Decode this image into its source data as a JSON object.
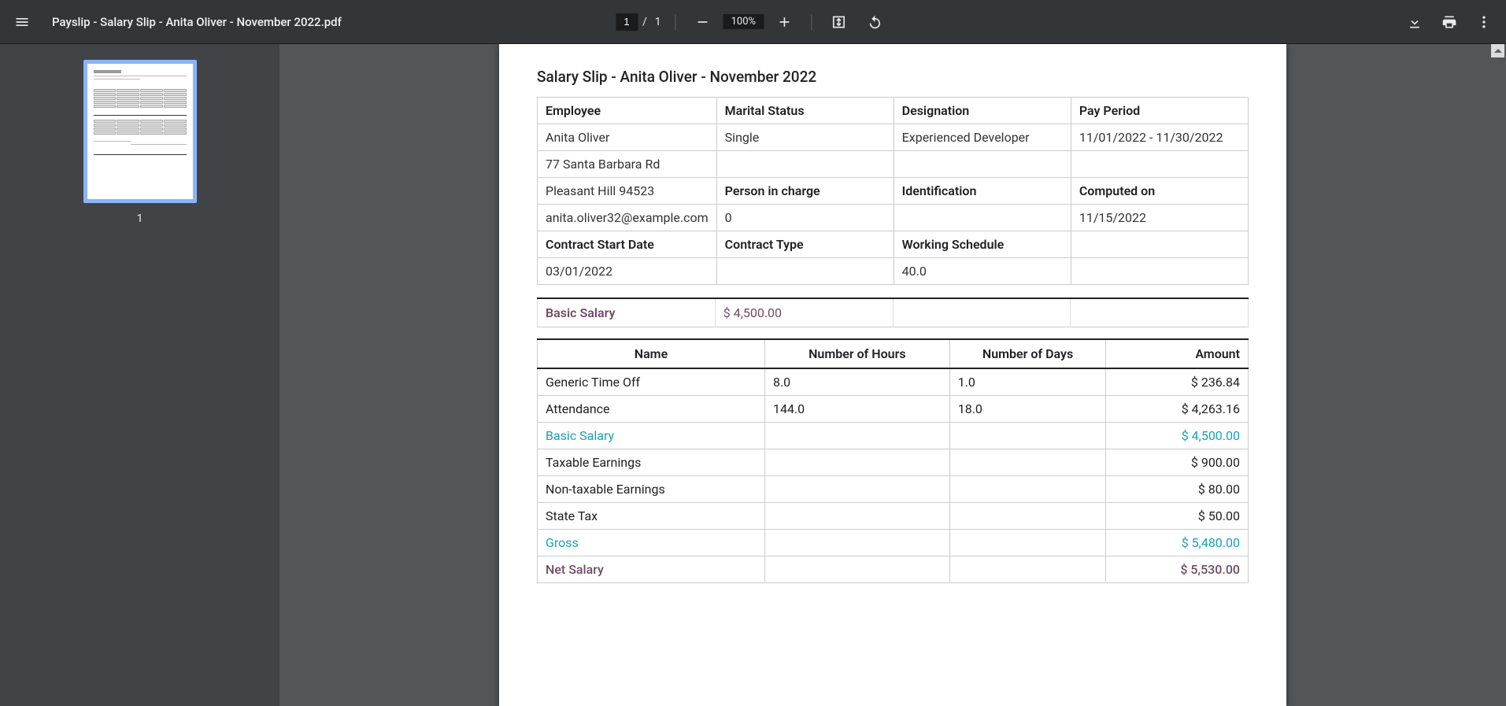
{
  "toolbar": {
    "title": "Payslip - Salary Slip - Anita Oliver - November 2022.pdf",
    "current_page": "1",
    "page_sep": "/",
    "total_pages": "1",
    "zoom": "100%"
  },
  "thumb": {
    "page_num": "1"
  },
  "doc": {
    "title": "Salary Slip - Anita Oliver - November 2022",
    "labels": {
      "employee": "Employee",
      "marital": "Marital Status",
      "designation": "Designation",
      "payperiod": "Pay Period",
      "person_in_charge": "Person in charge",
      "identification": "Identification",
      "computed_on": "Computed on",
      "contract_start": "Contract Start Date",
      "contract_type": "Contract Type",
      "working_schedule": "Working Schedule",
      "basic_salary": "Basic Salary"
    },
    "employee": {
      "name": "Anita Oliver",
      "marital": "Single",
      "designation": "Experienced Developer",
      "payperiod": "11/01/2022 - 11/30/2022",
      "addr1": "77 Santa Barbara Rd",
      "addr2": "Pleasant Hill 94523",
      "email": "anita.oliver32@example.com",
      "person_in_charge": "0",
      "identification": "",
      "computed_on": "11/15/2022",
      "contract_start": "03/01/2022",
      "contract_type": "",
      "working_schedule": "40.0"
    },
    "basic_salary_amount": "$ 4,500.00",
    "columns": {
      "name": "Name",
      "hours": "Number of Hours",
      "days": "Number of Days",
      "amount": "Amount"
    },
    "lines": [
      {
        "name": "Generic Time Off",
        "hours": "8.0",
        "days": "1.0",
        "amount": "$ 236.84",
        "style": ""
      },
      {
        "name": "Attendance",
        "hours": "144.0",
        "days": "18.0",
        "amount": "$ 4,263.16",
        "style": ""
      },
      {
        "name": "Basic Salary",
        "hours": "",
        "days": "",
        "amount": "$ 4,500.00",
        "style": "teal"
      },
      {
        "name": "Taxable Earnings",
        "hours": "",
        "days": "",
        "amount": "$ 900.00",
        "style": ""
      },
      {
        "name": "Non-taxable Earnings",
        "hours": "",
        "days": "",
        "amount": "$ 80.00",
        "style": ""
      },
      {
        "name": "State Tax",
        "hours": "",
        "days": "",
        "amount": "$ 50.00",
        "style": ""
      },
      {
        "name": "Gross",
        "hours": "",
        "days": "",
        "amount": "$ 5,480.00",
        "style": "teal"
      },
      {
        "name": "Net Salary",
        "hours": "",
        "days": "",
        "amount": "$ 5,530.00",
        "style": "purple"
      }
    ]
  }
}
